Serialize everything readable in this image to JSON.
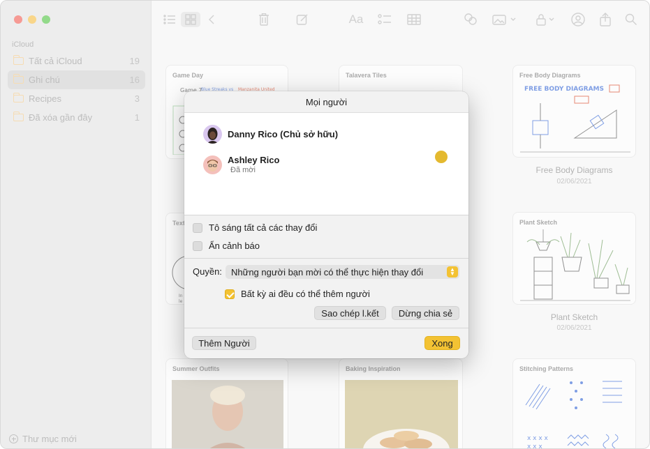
{
  "sidebar": {
    "section": "iCloud",
    "items": [
      {
        "label": "Tất cả iCloud",
        "count": "19"
      },
      {
        "label": "Ghi chú",
        "count": "16"
      },
      {
        "label": "Recipes",
        "count": "3"
      },
      {
        "label": "Đã xóa gần đây",
        "count": "1"
      }
    ],
    "new_folder": "Thư mục mới"
  },
  "toolbar": {
    "format_label": "Aa"
  },
  "gallery": {
    "cards": [
      {
        "title": "Game Day"
      },
      {
        "title": "Talavera Tiles"
      },
      {
        "title": "Free Body Diagrams",
        "caption": "Free Body Diagrams",
        "date": "02/06/2021"
      },
      {
        "title": "Text"
      },
      {
        "title": "Plant Sketch",
        "caption": "Plant Sketch",
        "date": "02/06/2021"
      },
      {
        "title": "Summer Outfits"
      },
      {
        "title": "Baking Inspiration"
      },
      {
        "title": "Stitching Patterns"
      }
    ]
  },
  "dialog": {
    "title": "Mọi người",
    "people": [
      {
        "name": "Danny Rico (Chủ sở hữu)",
        "status": ""
      },
      {
        "name": "Ashley Rico",
        "status": "Đã mời"
      }
    ],
    "options": {
      "highlight": "Tô sáng tất cả các thay đổi",
      "hide_alerts": "Ẩn cảnh báo"
    },
    "permission": {
      "label": "Quyền:",
      "value": "Những người bạn mời có thể thực hiện thay đổi",
      "anyone_add": "Bất kỳ ai đều có thể thêm người"
    },
    "buttons": {
      "copy_link": "Sao chép l.kết",
      "stop_sharing": "Dừng chia sẻ",
      "add_people": "Thêm Người",
      "done": "Xong"
    }
  },
  "colors": {
    "accent": "#f3c233",
    "owner_dot": "#e4b92f"
  }
}
